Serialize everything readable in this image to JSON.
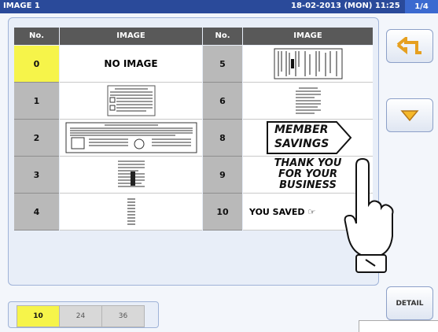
{
  "titlebar": {
    "title": "IMAGE 1",
    "datetime": "18-02-2013 (MON) 11:25",
    "page": "1/4"
  },
  "table": {
    "headers": [
      "No.",
      "IMAGE",
      "No.",
      "IMAGE"
    ],
    "rows": [
      {
        "left_no": "0",
        "left_image_text": "NO IMAGE",
        "right_no": "5",
        "right_image_text": ""
      },
      {
        "left_no": "1",
        "left_image_text": "",
        "right_no": "6",
        "right_image_text": ""
      },
      {
        "left_no": "2",
        "left_image_text": "",
        "right_no": "8",
        "right_image_text": "MEMBER SAVINGS"
      },
      {
        "left_no": "3",
        "left_image_text": "",
        "right_no": "9",
        "right_image_text": "THANK YOU FOR YOUR BUSINESS"
      },
      {
        "left_no": "4",
        "left_image_text": "",
        "right_no": "10",
        "right_image_text": "YOU SAVED"
      }
    ],
    "selected_no": "0"
  },
  "buttons": {
    "back_icon": "return-arrow-icon",
    "down_icon": "triangle-down-icon",
    "detail": "DETAIL"
  },
  "tabs": {
    "items": [
      "10",
      "24",
      "36"
    ],
    "selected": "10"
  },
  "member_savings": {
    "line1": "MEMBER",
    "line2": "SAVINGS"
  },
  "thank_you": {
    "line1": "THANK YOU",
    "line2": "FOR YOUR",
    "line3": "BUSINESS"
  }
}
